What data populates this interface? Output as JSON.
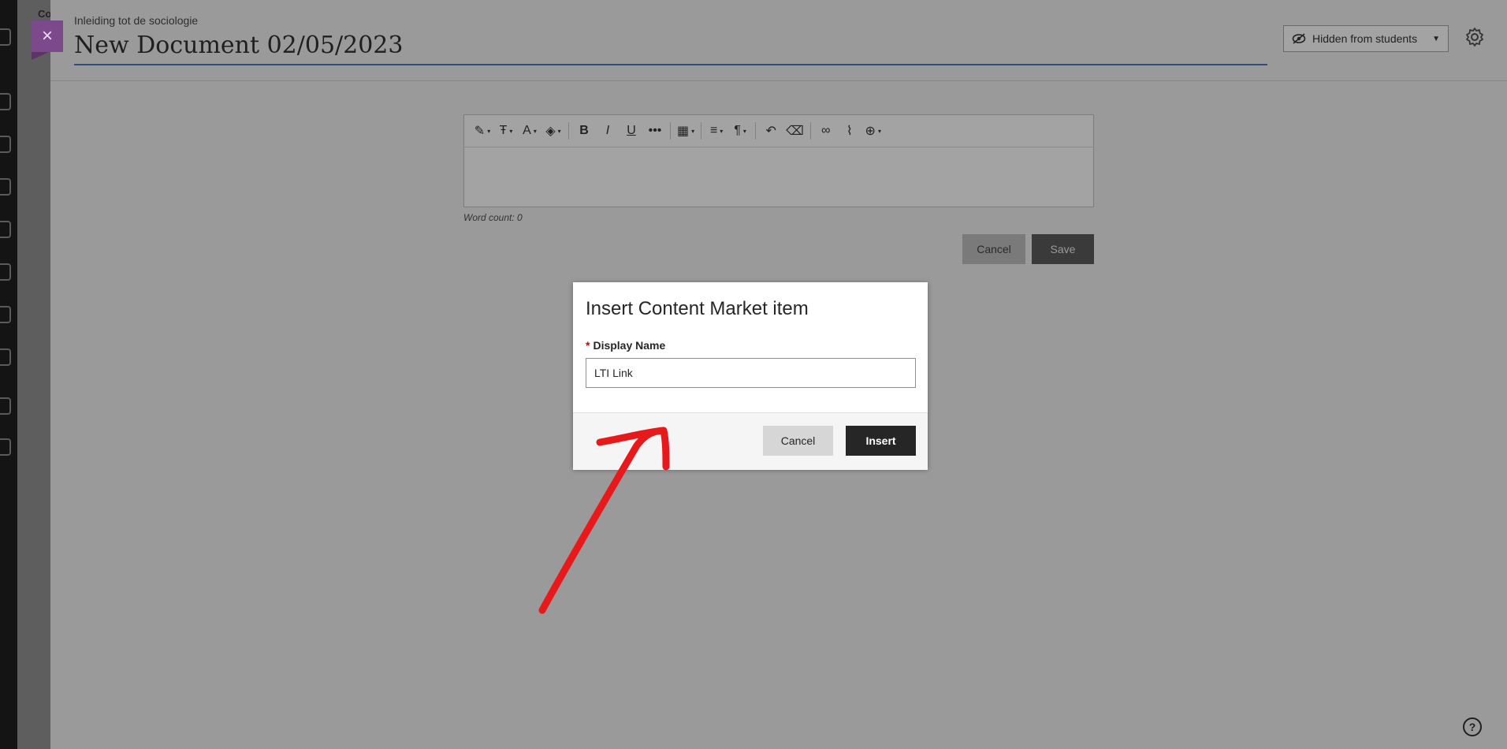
{
  "breadcrumb": "Inleiding tot de sociologie",
  "document_title": "New Document 02/05/2023",
  "visibility": {
    "label": "Hidden from students",
    "icon": "eye-slash-icon"
  },
  "editor": {
    "toolbar": [
      "paragraph-style",
      "text-format",
      "font-size",
      "highlight",
      "bold",
      "italic",
      "underline",
      "more",
      "table",
      "align",
      "paragraph",
      "undo",
      "clear-format",
      "link",
      "attach",
      "insert-content"
    ],
    "word_count": "Word count: 0",
    "cancel_label": "Cancel",
    "save_label": "Save"
  },
  "modal": {
    "title": "Insert Content Market item",
    "required_mark": "*",
    "field_label": "Display Name",
    "field_value": "LTI Link",
    "cancel_label": "Cancel",
    "insert_label": "Insert"
  },
  "colors": {
    "overlay": "#9a9a9a",
    "accent_purple": "#7c4a8c",
    "annotation": "#e8191b",
    "title_underline": "#2f4d7a"
  }
}
